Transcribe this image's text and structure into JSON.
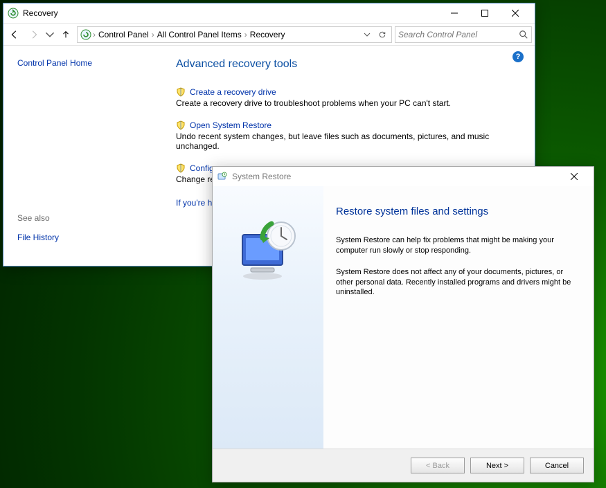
{
  "recovery": {
    "title": "Recovery",
    "breadcrumb": [
      "Control Panel",
      "All Control Panel Items",
      "Recovery"
    ],
    "search_placeholder": "Search Control Panel",
    "sidebar": {
      "home": "Control Panel Home",
      "seealso_label": "See also",
      "seealso_item": "File History"
    },
    "heading": "Advanced recovery tools",
    "tools": [
      {
        "title": "Create a recovery drive",
        "desc": "Create a recovery drive to troubleshoot problems when your PC can't start."
      },
      {
        "title": "Open System Restore",
        "desc": "Undo recent system changes, but leave files such as documents, pictures, and music unchanged."
      },
      {
        "title": "Configure",
        "desc": "Change resto"
      }
    ],
    "prompt": "If you're havi"
  },
  "restore": {
    "title": "System Restore",
    "heading": "Restore system files and settings",
    "p1": "System Restore can help fix problems that might be making your computer run slowly or stop responding.",
    "p2": "System Restore does not affect any of your documents, pictures, or other personal data. Recently installed programs and drivers might be uninstalled.",
    "buttons": {
      "back": "< Back",
      "next": "Next >",
      "cancel": "Cancel"
    }
  }
}
